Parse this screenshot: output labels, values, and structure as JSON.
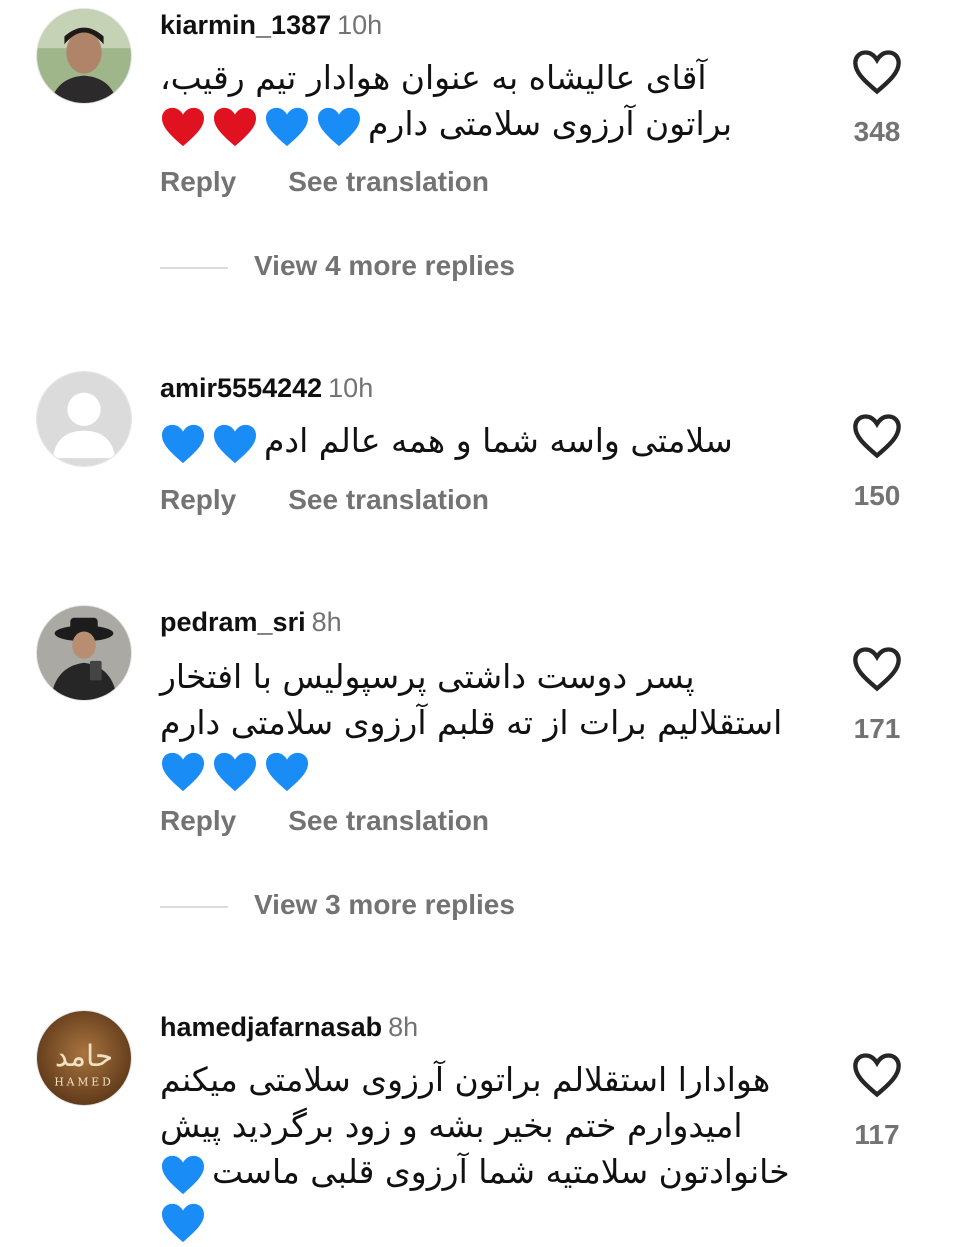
{
  "actions": {
    "reply": "Reply",
    "see_translation": "See translation"
  },
  "comments": [
    {
      "username": "kiarmin_1387",
      "time": "10h",
      "lines": [
        "آقای عالیشاه به عنوان هوادار تیم رقیب،",
        "براتون آرزوی سلامتی دارم"
      ],
      "emoji": [
        "blue-heart",
        "blue-heart",
        "red-heart",
        "red-heart"
      ],
      "likes": "348",
      "more_replies": "View 4 more replies"
    },
    {
      "username": "amir5554242",
      "time": "10h",
      "lines": [
        "سلامتی واسه شما و همه عالم ادم"
      ],
      "emoji": [
        "blue-heart",
        "blue-heart"
      ],
      "likes": "150"
    },
    {
      "username": "pedram_sri",
      "time": "8h",
      "lines": [
        "پسر دوست داشتی پرسپولیس با افتخار",
        "استقلالیم برات از ته قلبم آرزوی سلامتی دارم"
      ],
      "emoji": [
        "blue-heart",
        "blue-heart",
        "blue-heart"
      ],
      "likes": "171",
      "more_replies": "View 3 more replies"
    },
    {
      "username": "hamedjafarnasab",
      "time": "8h",
      "lines": [
        "هوادارا استقلالم براتون آرزوی سلامتی میکنم",
        "امیدوارم ختم بخیر بشه و زود برگردید پیش",
        "خانوادتون سلامتیه شما آرزوی قلبی ماست"
      ],
      "emoji": [
        "blue-heart",
        "blue-heart"
      ],
      "likes": "117",
      "avatar_text": "حامد",
      "avatar_subtext": "HAMED"
    }
  ],
  "colors": {
    "blue_heart": "#1a8cf5",
    "red_heart": "#e0121f",
    "secondary_text": "#737373"
  }
}
